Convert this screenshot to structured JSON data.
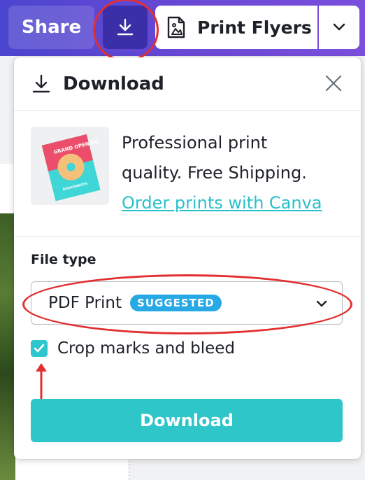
{
  "toolbar": {
    "share_label": "Share",
    "download_icon": "download-icon",
    "print_label": "Print Flyers",
    "print_icon": "print-document-icon",
    "dropdown_icon": "chevron-down-icon",
    "gradient_start": "#4b45cf",
    "gradient_end": "#7a4fdc"
  },
  "panel": {
    "title": "Download",
    "title_icon": "download-icon",
    "close_icon": "close-icon",
    "promo": {
      "line1": "Professional print",
      "line2": "quality. Free Shipping.",
      "link": "Order prints with Canva",
      "thumbnail_title": "GRAND OPENING",
      "thumbnail_subtitle": "DOUGHNUTS"
    },
    "file_type": {
      "label": "File type",
      "value": "PDF Print",
      "badge": "SUGGESTED"
    },
    "crop_marks": {
      "label": "Crop marks and bleed",
      "checked": true
    },
    "download_button": "Download"
  },
  "colors": {
    "accent_teal": "#2ec6c9",
    "link": "#27c1cb",
    "badge": "#27a9e6",
    "annotation_red": "#e23030"
  }
}
